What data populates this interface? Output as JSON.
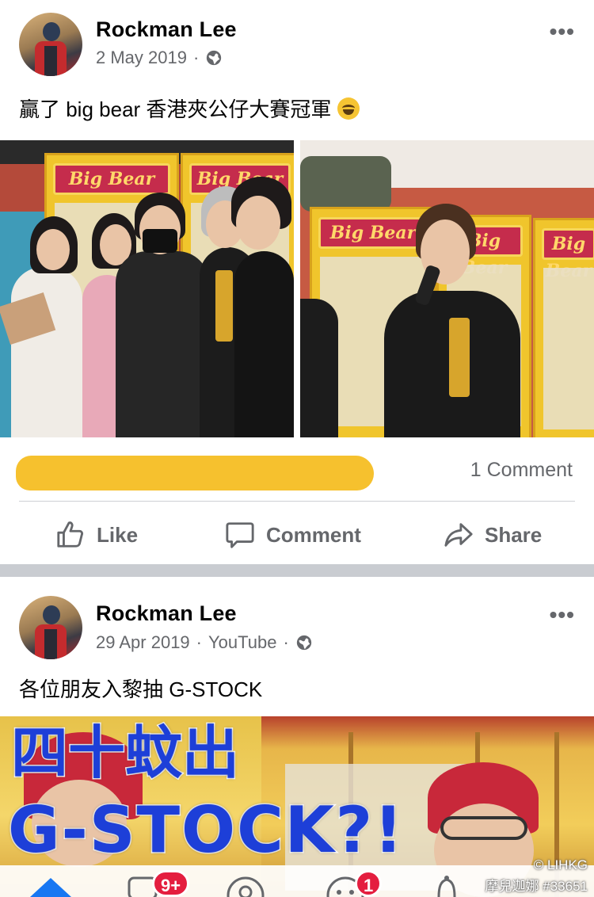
{
  "posts": [
    {
      "author": "Rockman Lee",
      "date": "2 May 2019",
      "separator": "·",
      "text": "贏了 big bear 香港夾公仔大賽冠軍",
      "emoji": "rolling-on-floor-laughing-emoji",
      "photo_signs": [
        "Big Bear",
        "Big Bear",
        "Big Bear",
        "Big Bear",
        "Big Bear"
      ],
      "comment_count": "1 Comment",
      "actions": {
        "like": "Like",
        "comment": "Comment",
        "share": "Share"
      }
    },
    {
      "author": "Rockman Lee",
      "date": "29 Apr 2019",
      "source": "YouTube",
      "separator": "·",
      "text": "各位朋友入黎抽 G-STOCK",
      "thumbnail_line1": "四十蚊出",
      "thumbnail_line2": "G-STOCK?!"
    }
  ],
  "more_icon": "•••",
  "tabbar": {
    "notifications_badge": "9+",
    "groups_badge": "1"
  },
  "watermark": {
    "line1": "© LIHKG",
    "line2": "摩兒迦娜 #33651"
  },
  "colors": {
    "redaction": "#f6c12e",
    "badge": "#e41e3f",
    "meta": "#65676b",
    "divider": "#c9ccd1",
    "fb_blue": "#1877f2"
  }
}
